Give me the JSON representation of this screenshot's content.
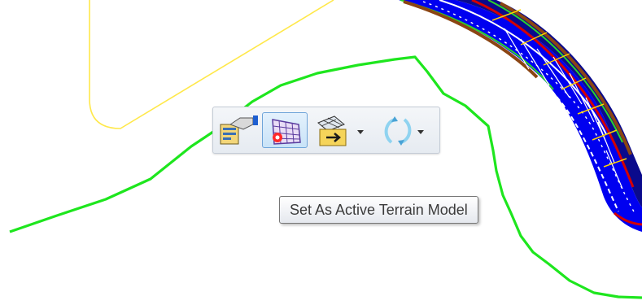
{
  "toolbar": {
    "buttons": [
      {
        "name": "terrain-properties",
        "icon": "element-info-icon"
      },
      {
        "name": "set-active-terrain-model",
        "icon": "terrain-mesh-icon",
        "active": true
      },
      {
        "name": "terrain-export",
        "icon": "terrain-export-icon",
        "dropdown": true
      },
      {
        "name": "terrain-refresh",
        "icon": "refresh-icon",
        "dropdown": true
      }
    ]
  },
  "tooltip": {
    "text": "Set As Active Terrain Model"
  },
  "colors": {
    "terrain_boundary": "#1ee61e",
    "alignment_line": "#ffe84a",
    "road_fill": "#0000f0",
    "toolbar_active_border": "#6fa4d9"
  }
}
